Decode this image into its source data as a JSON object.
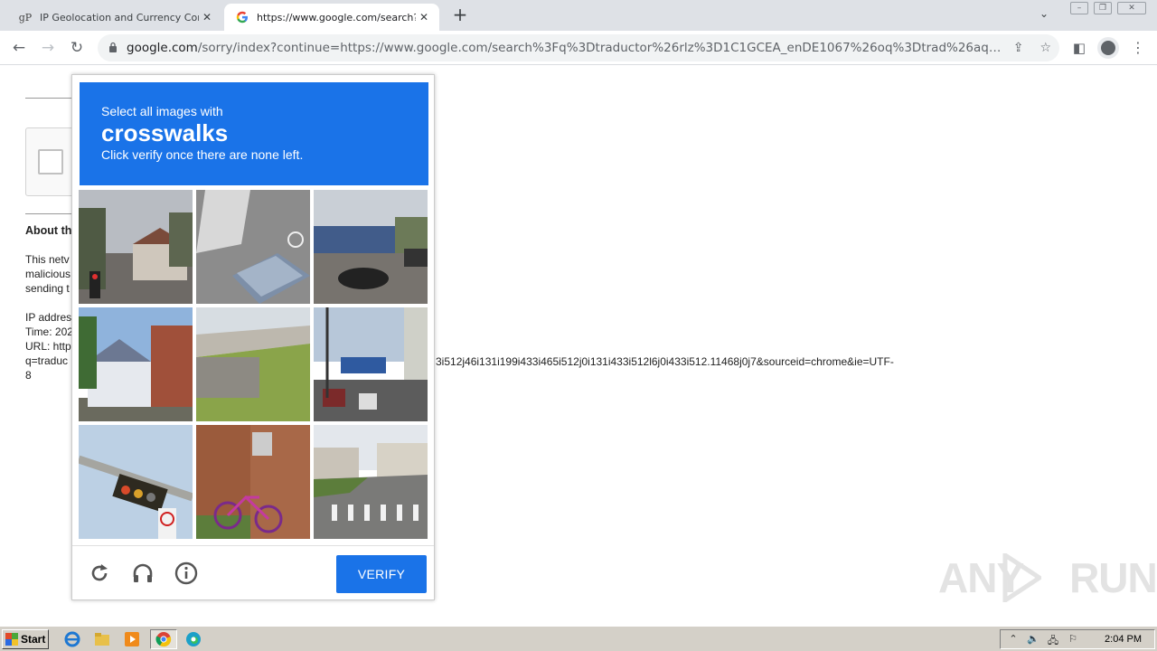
{
  "browser": {
    "tabs": [
      {
        "label": "IP Geolocation and Currency Conver",
        "favicon": "gP",
        "active": false
      },
      {
        "label": "https://www.google.com/search?q=",
        "favicon": "google-g",
        "active": true
      }
    ],
    "new_tab_label": "+",
    "url_host": "google.com",
    "url_path": "/sorry/index?continue=https://www.google.com/search%3Fq%3Dtraductor%26rlz%3D1C1GCEA_enDE1067%26oq%3Dtrad%26aqs%3Dch..."
  },
  "background_page": {
    "about_heading": "About th",
    "lines": [
      "This netv",
      "malicious",
      "sending t"
    ],
    "meta_lines": [
      "IP addres",
      "Time: 202",
      "URL: http",
      "q=traduc",
      "8"
    ],
    "url_tail": "3i512j46i131i199i433i465i512j0i131i433i512l6j0i433i512.11468j0j7&sourceid=chrome&ie=UTF-"
  },
  "captcha": {
    "instruction": "Select all images with",
    "target": "crosswalks",
    "subtext": "Click verify once there are none left.",
    "verify_label": "VERIFY",
    "tiles": [
      "street-traffic-light-houses",
      "bike-lane-drain-grate",
      "gas-station-street-car",
      "house-red-roof",
      "highway-overpass-grass",
      "city-intersection-traffic",
      "traffic-light-sign",
      "brick-wall-bicycle",
      "street-with-crosswalk"
    ]
  },
  "watermark": "ANY RUN",
  "taskbar": {
    "start_label": "Start",
    "clock": "2:04 PM"
  }
}
